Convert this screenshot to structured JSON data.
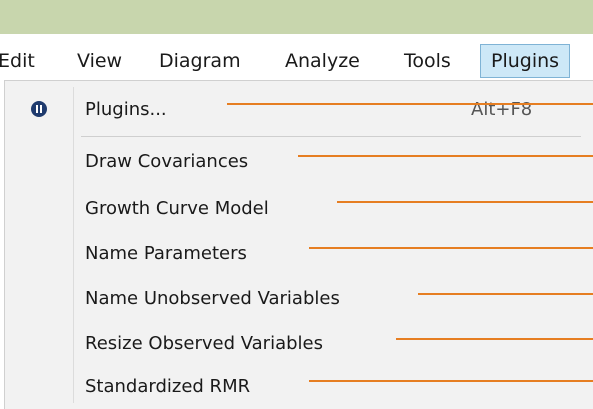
{
  "menubar": {
    "items": [
      {
        "label": "Edit"
      },
      {
        "label": "View"
      },
      {
        "label": "Diagram"
      },
      {
        "label": "Analyze"
      },
      {
        "label": "Tools"
      },
      {
        "label": "Plugins",
        "active": true
      }
    ]
  },
  "dropdown": {
    "plugins_item": {
      "label": "Plugins...",
      "shortcut": "Alt+F8",
      "icon": "plugin-icon"
    },
    "items": [
      {
        "label": "Draw Covariances"
      },
      {
        "label": "Growth Curve Model"
      },
      {
        "label": "Name Parameters"
      },
      {
        "label": "Name Unobserved Variables"
      },
      {
        "label": "Resize Observed Variables"
      },
      {
        "label": "Standardized RMR"
      }
    ]
  },
  "colors": {
    "titlebar": "#c8d6ad",
    "active_menu_bg": "#cde8f7",
    "active_menu_border": "#7fb3d5",
    "dropdown_bg": "#f2f2f2",
    "callout_line": "#e67e22",
    "plugin_icon": "#1f3b6e"
  }
}
